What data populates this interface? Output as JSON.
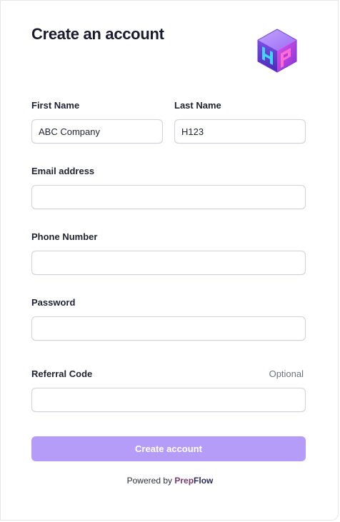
{
  "header": {
    "title": "Create an account",
    "logo_icon": "prepflow-cube-logo-icon"
  },
  "form": {
    "first_name": {
      "label": "First Name",
      "value": "ABC Company"
    },
    "last_name": {
      "label": "Last Name",
      "value": "H123"
    },
    "email": {
      "label": "Email address",
      "value": ""
    },
    "phone": {
      "label": "Phone Number",
      "value": ""
    },
    "password": {
      "label": "Password",
      "value": ""
    },
    "referral": {
      "label": "Referral Code",
      "hint": "Optional",
      "value": ""
    },
    "submit_label": "Create account"
  },
  "footer": {
    "powered_by": "Powered by",
    "brand_prep": "Prep",
    "brand_flow": "Flow"
  },
  "colors": {
    "button_bg": "#b69cf9",
    "brand_prep": "#7b3a6e",
    "brand_flow": "#2a2d5a"
  }
}
